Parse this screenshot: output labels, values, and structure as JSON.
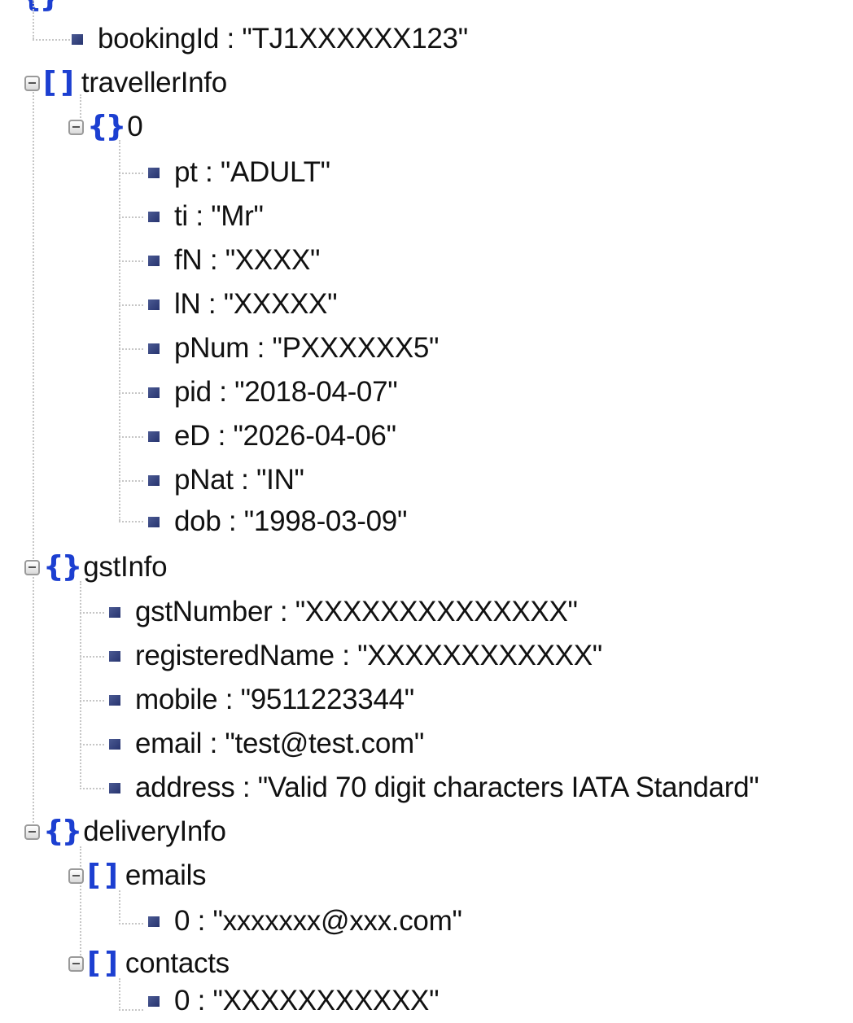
{
  "root_glyph": "{}",
  "items": [
    {
      "key": "bookingId",
      "value": "\"TJ1XXXXXX123\""
    },
    {
      "key": "travellerInfo",
      "glyph": "[]"
    },
    {
      "key": "0",
      "glyph": "{}"
    },
    {
      "key": "pt",
      "value": "\"ADULT\""
    },
    {
      "key": "ti",
      "value": "\"Mr\""
    },
    {
      "key": "fN",
      "value": "\"XXXX\""
    },
    {
      "key": "lN",
      "value": "\"XXXXX\""
    },
    {
      "key": "pNum",
      "value": "\"PXXXXXX5\""
    },
    {
      "key": "pid",
      "value": "\"2018-04-07\""
    },
    {
      "key": "eD",
      "value": "\"2026-04-06\""
    },
    {
      "key": "pNat",
      "value": "\"IN\""
    },
    {
      "key": "dob",
      "value": "\"1998-03-09\""
    },
    {
      "key": "gstInfo",
      "glyph": "{}"
    },
    {
      "key": "gstNumber",
      "value": "\"XXXXXXXXXXXXXX\""
    },
    {
      "key": "registeredName",
      "value": "\"XXXXXXXXXXXX\""
    },
    {
      "key": "mobile",
      "value": "\"9511223344\""
    },
    {
      "key": "email",
      "value": "\"test@test.com\""
    },
    {
      "key": "address",
      "value": "\"Valid 70 digit characters IATA Standard\""
    },
    {
      "key": "deliveryInfo",
      "glyph": "{}"
    },
    {
      "key": "emails",
      "glyph": "[]"
    },
    {
      "key": "0",
      "value": "\"xxxxxxx@xxx.com\""
    },
    {
      "key": "contacts",
      "glyph": "[]"
    },
    {
      "key": "0",
      "value": "\"XXXXXXXXXXX\""
    }
  ]
}
